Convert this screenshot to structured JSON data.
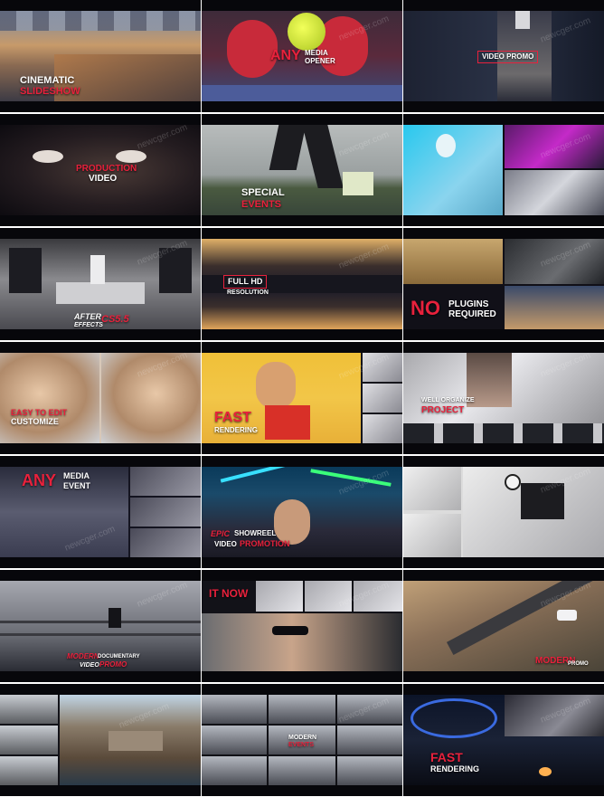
{
  "watermark": "newcger.com",
  "accent": "#e8213c",
  "cells": {
    "c1": [
      "CINEMATIC",
      "SLIDESHOW"
    ],
    "c2": [
      "ANY",
      "MEDIA",
      "OPENER"
    ],
    "c3": [
      "VIDEO PROMO"
    ],
    "c4": [
      "PRODUCTION",
      "VIDEO"
    ],
    "c5": [
      "SPECIAL",
      "EVENTS"
    ],
    "c7": [
      "AFTER",
      "EFFECTS",
      "CS5.5"
    ],
    "c8": [
      "FULL HD",
      "RESOLUTION"
    ],
    "c9": [
      "NO",
      "PLUGINS",
      "REQUIRED"
    ],
    "c10": [
      "EASY TO EDIT",
      "CUSTOMIZE"
    ],
    "c11": [
      "FAST",
      "RENDERING"
    ],
    "c12": [
      "WELL ORGANIZE",
      "PROJECT"
    ],
    "c13": [
      "ANY",
      "MEDIA",
      "EVENT"
    ],
    "c14": [
      "EPIC",
      "SHOWREEL",
      "VIDEO",
      "PROMOTION"
    ],
    "c16": [
      "MODERN",
      "DOCUMENTARY",
      "VIDEO",
      "PROMO"
    ],
    "c17": [
      "IT NOW"
    ],
    "c18": [
      "MODERN",
      "PROMO"
    ],
    "c20": [
      "MODERN",
      "EVENTS"
    ],
    "c21": [
      "FAST",
      "RENDERING"
    ]
  }
}
